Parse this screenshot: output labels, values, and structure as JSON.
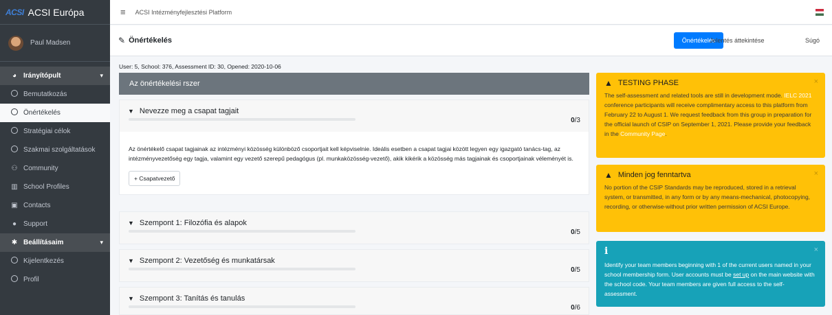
{
  "brand": {
    "logo": "ACSI",
    "name": "ACSI Európa"
  },
  "user": {
    "name": "Paul Madsen"
  },
  "nav": {
    "dashboard": "Irányítópult",
    "items": [
      {
        "label": "Bemutatkozás"
      },
      {
        "label": "Önértékelés",
        "active": true
      },
      {
        "label": "Stratégiai célok"
      },
      {
        "label": "Szakmai szolgáltatások"
      },
      {
        "label": "Community"
      },
      {
        "label": "School Profiles"
      },
      {
        "label": "Contacts"
      },
      {
        "label": "Support"
      }
    ],
    "settings": "Beállításaim",
    "settings_items": [
      {
        "label": "Kijelentkezés"
      },
      {
        "label": "Profil"
      }
    ]
  },
  "topbar": {
    "platform": "ACSI Intézményfejlesztési Platform"
  },
  "header": {
    "title": "Önértékelés",
    "primary_button": "Önértékelés",
    "report_link": "Jelentés áttekintése",
    "help_link": "Súgó"
  },
  "meta": "User: 5, School: 376, Assessment ID: 30, Opened: 2020-10-06",
  "card_title": "Az önértékelési rszer",
  "sections": [
    {
      "title": "Nevezze meg a csapat tagjait",
      "score": "0",
      "total": "/3"
    },
    {
      "title": "Szempont 1: Filozófia és alapok",
      "score": "0",
      "total": "/5"
    },
    {
      "title": "Szempont 2: Vezetőség és munkatársak",
      "score": "0",
      "total": "/5"
    },
    {
      "title": "Szempont 3: Tanítás és tanulás",
      "score": "0",
      "total": "/6"
    }
  ],
  "team_body": "Az önértékelő csapat tagjainak az intézményi közösség különböző csoportjait kell képviselnie. Ideális esetben a csapat tagjai között legyen egy igazgató tanács-tag, az intézményvezetőség egy tagja, valamint egy vezető szerepű pedagógus (pl. munkaközösség-vezető), akik kikérik a közösség más tagjainak és csoportjainak véleményét is.",
  "team_button": "+ Csapatvezető",
  "alerts": {
    "testing": {
      "title": "TESTING PHASE",
      "p1": "The self-assessment and related tools are still in development mode.",
      "highlight": "IELC 2021",
      "p2": "conference participants will receive complimentary access to this platform from February 22 to August 1. We request feedback from this group in preparation for the official launch of CSIP on September 1, 2021. Please provide your feedback in the",
      "link": "Community Page",
      "p3": "."
    },
    "rights": {
      "title": "Minden jog fenntartva",
      "body": "No portion of the CSIP Standards may be reproduced, stored in a retrieval system, or transmitted, in any form or by any means-mechanical, photocopying, recording, or otherwise-without prior written permission of ACSI Europe."
    },
    "info": {
      "icon": "i",
      "p1": "Identify your team members beginning with 1 of the current users named in your school membership form. User accounts must be",
      "link": "set up",
      "p2": "on the main website with the school code. Your team members are given full access to the self-assessment."
    }
  },
  "colors": {
    "sidebar": "#343a40",
    "primary": "#007bff",
    "warning": "#ffc107",
    "info": "#17a2b8",
    "card_header": "#6c757d"
  }
}
